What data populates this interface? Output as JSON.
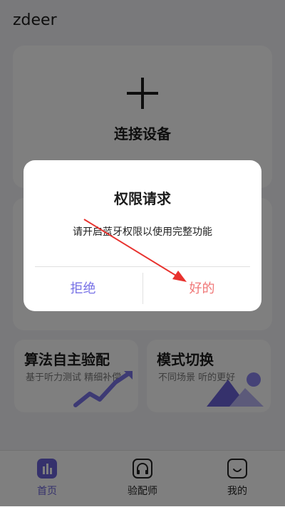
{
  "app": {
    "title": "zdeer"
  },
  "connect_card": {
    "label": "连接设备"
  },
  "features": [
    {
      "title": "算法自主验配",
      "subtitle": "基于听力测试 精细补偿"
    },
    {
      "title": "模式切换",
      "subtitle": "不同场景 听的更好"
    }
  ],
  "nav": {
    "items": [
      {
        "label": "首页",
        "icon": "home-bars-icon",
        "active": true
      },
      {
        "label": "验配师",
        "icon": "headphones-icon",
        "active": false
      },
      {
        "label": "我的",
        "icon": "smile-face-icon",
        "active": false
      }
    ]
  },
  "dialog": {
    "title": "权限请求",
    "message": "请开启蓝牙权限以使用完整功能",
    "deny_label": "拒绝",
    "ok_label": "好的"
  },
  "colors": {
    "accent": "#6a63d8",
    "deny": "#7771e6",
    "ok": "#f07878",
    "annotation_arrow": "#e8322e",
    "overlay": "rgba(0,0,0,0.5)"
  }
}
